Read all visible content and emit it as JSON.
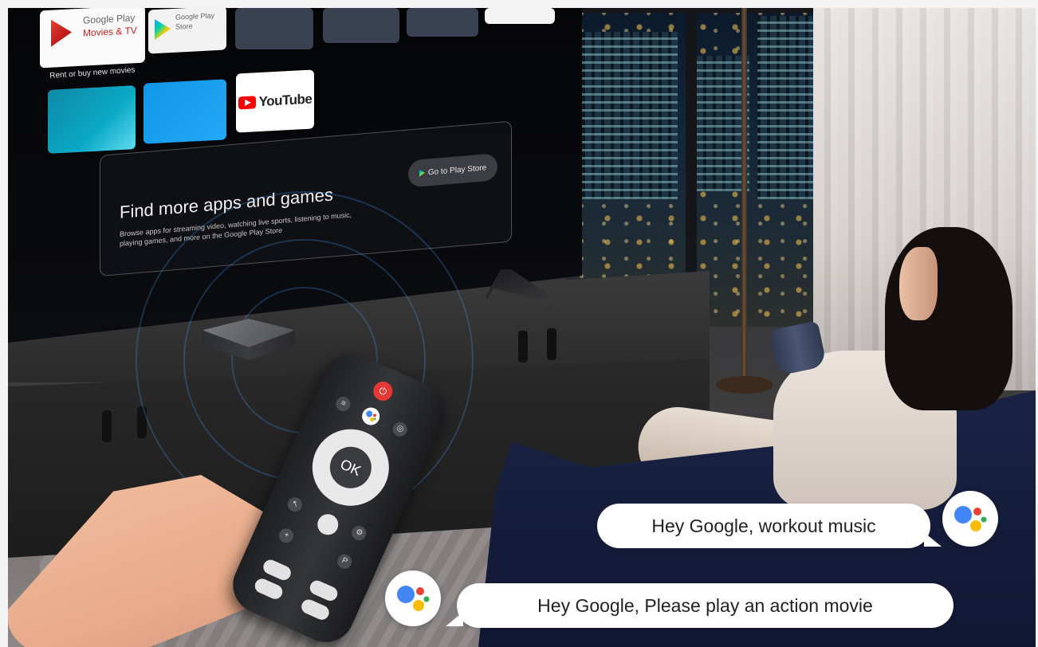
{
  "tv_screen": {
    "tiles": {
      "google_play_movies": {
        "title": "Google Play",
        "subtitle": "Movies & TV"
      },
      "google_play_store": {
        "title": "Google Play",
        "subtitle": "Store"
      },
      "youtube": {
        "label": "YouTube"
      }
    },
    "rent_label": "Rent or buy new movies",
    "find_more": {
      "title": "Find more apps and games",
      "description": "Browse apps for streaming video, watching live sports, listening to music, playing games, and more on the Google Play Store",
      "button": "Go to Play Store"
    }
  },
  "remote": {
    "ok_label": "OK",
    "power_symbol": "⏻"
  },
  "speech_bubbles": [
    {
      "text": "Hey Google, workout music"
    },
    {
      "text": "Hey Google, Please play an action movie"
    }
  ],
  "colors": {
    "assistant_blue": "#4285F4",
    "assistant_red": "#EA4335",
    "assistant_yellow": "#FBBC05",
    "assistant_green": "#34A853",
    "youtube_red": "#FF0000",
    "power_red": "#E53935"
  },
  "icons": [
    "google-play-movies-icon",
    "google-play-store-icon",
    "youtube-logo-icon",
    "google-assistant-icon",
    "power-icon"
  ]
}
